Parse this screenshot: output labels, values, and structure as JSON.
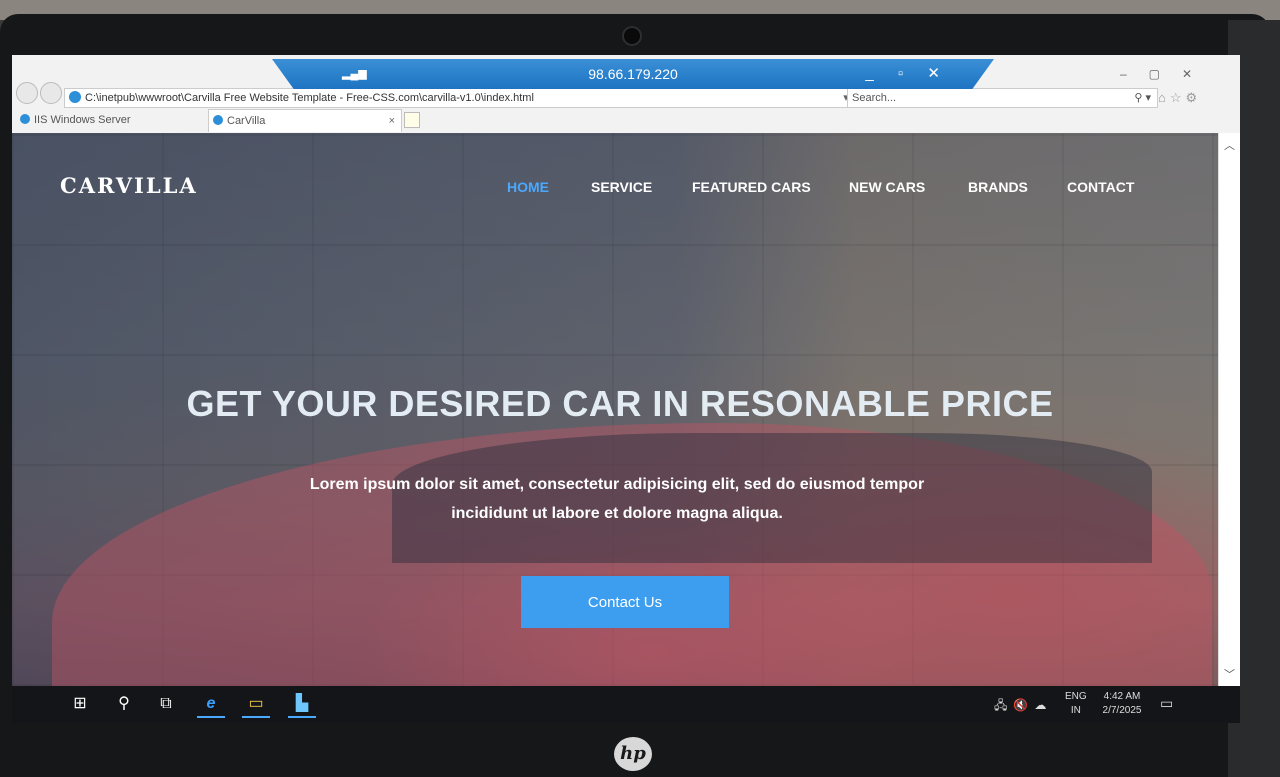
{
  "rdp": {
    "ip": "98.66.179.220",
    "controls": "_ ▫ ✕",
    "signal": "▂▄▆"
  },
  "browser": {
    "address": "C:\\inetpub\\wwwroot\\Carvilla Free Website Template - Free-CSS.com\\carvilla-v1.0\\index.html",
    "address_tools": "▾ ↻",
    "search_placeholder": "Search...",
    "tabs": [
      {
        "label": "IIS Windows Server"
      },
      {
        "label": "CarVilla"
      }
    ],
    "tab_close": "×",
    "window_controls": "–▢✕",
    "toolbar_icons": "⌂☆⚙"
  },
  "site": {
    "brand": "CARVILLA",
    "nav": [
      {
        "label": "HOME"
      },
      {
        "label": "SERVICE"
      },
      {
        "label": "FEATURED CARS"
      },
      {
        "label": "NEW CARS"
      },
      {
        "label": "BRANDS"
      },
      {
        "label": "CONTACT"
      }
    ],
    "hero_title": "GET YOUR DESIRED CAR IN RESONABLE PRICE",
    "hero_text": "Lorem ipsum dolor sit amet, consectetur adipisicing elit, sed do eiusmod tempor incididunt ut labore et dolore magna aliqua.",
    "cta": "Contact Us"
  },
  "taskbar": {
    "lang_1": "ENG",
    "lang_2": "IN",
    "time": "4:42 AM",
    "date": "2/7/2025"
  },
  "device": {
    "logo": "hp"
  },
  "colors": {
    "accent": "#4aa8ff",
    "cta": "#3d9ef0",
    "rdp": "#1e74c2"
  }
}
